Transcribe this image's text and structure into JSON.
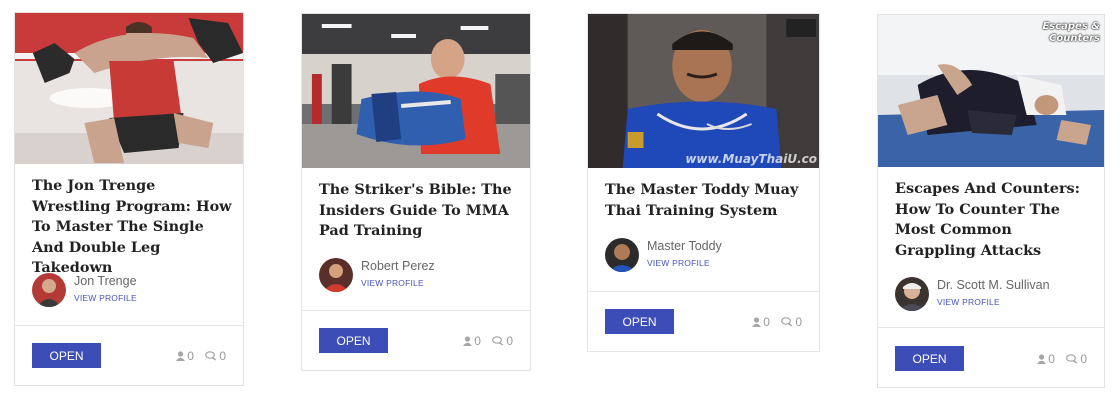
{
  "colors": {
    "open_button": "#3d4db8",
    "view_profile": "#4a55b8",
    "title_text": "#222222",
    "meta_text": "#9a9a9a"
  },
  "courses": [
    {
      "title": "The Jon Trenge Wrestling Program: How To Master The Single And Double Leg Takedown",
      "thumbnail_subject": "wrestling-takedown-photo",
      "author": "Jon Trenge",
      "view_profile": "VIEW PROFILE",
      "open_label": "OPEN",
      "students": "0",
      "comments": "0"
    },
    {
      "title": "The Striker's Bible: The Insiders Guide To MMA Pad Training",
      "thumbnail_subject": "mma-pad-training-photo",
      "author": "Robert Perez",
      "view_profile": "VIEW PROFILE",
      "open_label": "OPEN",
      "students": "0",
      "comments": "0"
    },
    {
      "title": "The Master Toddy Muay Thai Training System",
      "thumbnail_subject": "muay-thai-master-photo",
      "thumbnail_watermark": "www.MuayThaiU.co",
      "author": "Master Toddy",
      "view_profile": "VIEW PROFILE",
      "open_label": "OPEN",
      "students": "0",
      "comments": "0"
    },
    {
      "title": "Escapes And Counters: How To Counter The Most Common Grappling Attacks",
      "thumbnail_subject": "grappling-mat-photo",
      "thumbnail_caption": "Escapes & Counters",
      "author": "Dr. Scott M. Sullivan",
      "view_profile": "VIEW PROFILE",
      "open_label": "OPEN",
      "students": "0",
      "comments": "0"
    }
  ]
}
